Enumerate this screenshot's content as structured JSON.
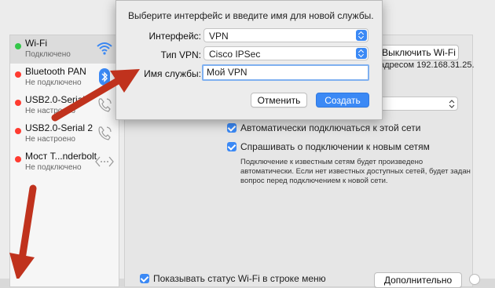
{
  "sidebar": {
    "items": [
      {
        "name": "Wi-Fi",
        "status": "Подключено",
        "dot": "#34c749",
        "icon": "wifi-icon"
      },
      {
        "name": "Bluetooth PAN",
        "status": "Не подключено",
        "dot": "#ff3b30",
        "icon": "bluetooth-icon"
      },
      {
        "name": "USB2.0-Serial",
        "status": "Не настроено",
        "dot": "#ff3b30",
        "icon": "phone-icon"
      },
      {
        "name": "USB2.0-Serial 2",
        "status": "Не настроено",
        "dot": "#ff3b30",
        "icon": "phone-icon"
      },
      {
        "name": "Мост T...nderbolt",
        "status": "Не подключено",
        "dot": "#ff3b30",
        "icon": "bridge-icon"
      }
    ]
  },
  "main": {
    "wifi_off_button": "Выключить Wi-Fi",
    "ip_text": "адресом 192.168.31.25.",
    "auto_connect_label": "Автоматически подключаться к этой сети",
    "ask_label": "Спрашивать о подключении к новым сетям",
    "info_text_1": "Подключение к известным сетям будет произведено",
    "info_text_2": "автоматически. Если нет известных доступных сетей, будет задан",
    "info_text_3": "вопрос перед подключением к новой сети.",
    "show_status_label": "Показывать статус Wi-Fi в строке меню",
    "advanced_button": "Дополнительно"
  },
  "dialog": {
    "title": "Выберите интерфейс и введите имя для новой службы.",
    "interface_label": "Интерфейс:",
    "interface_value": "VPN",
    "vpn_type_label": "Тип VPN:",
    "vpn_type_value": "Cisco IPSec",
    "service_name_label": "Имя службы:",
    "service_name_value": "Мой VPN",
    "cancel_button": "Отменить",
    "create_button": "Создать"
  },
  "colors": {
    "accent": "#3b89f5",
    "arrow": "#c0321d"
  }
}
